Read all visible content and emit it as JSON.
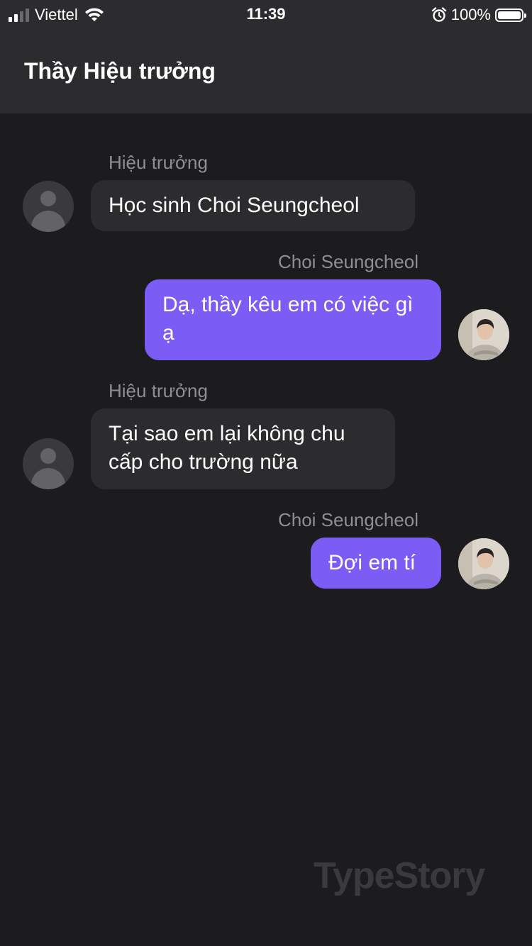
{
  "status_bar": {
    "carrier": "Viettel",
    "time": "11:39",
    "battery_percent": "100%",
    "signal_bars": 2,
    "icons": [
      "signal-icon",
      "wifi-icon",
      "alarm-icon",
      "battery-icon"
    ]
  },
  "header": {
    "title": "Thầy Hiệu trưởng"
  },
  "messages": [
    {
      "sender": "Hiệu trưởng",
      "text": "Học sinh Choi Seungcheol",
      "direction": "incoming",
      "avatar": "default-avatar-icon"
    },
    {
      "sender": "Choi Seungcheol",
      "text": "Dạ, thầy kêu em có việc gì ạ",
      "direction": "outgoing",
      "avatar": "profile-photo"
    },
    {
      "sender": "Hiệu trưởng",
      "text": "Tại sao em lại không chu cấp cho trường nữa",
      "direction": "incoming",
      "avatar": "default-avatar-icon"
    },
    {
      "sender": "Choi Seungcheol",
      "text": "Đợi em tí",
      "direction": "outgoing",
      "avatar": "profile-photo"
    }
  ],
  "watermark": "TypeStory",
  "colors": {
    "background": "#1c1c1e",
    "header": "#2c2c2e",
    "incoming_bubble": "#2c2c2e",
    "outgoing_bubble": "#7b5cf5",
    "sender_label": "#8e8e93",
    "watermark": "#3a3a3c"
  }
}
